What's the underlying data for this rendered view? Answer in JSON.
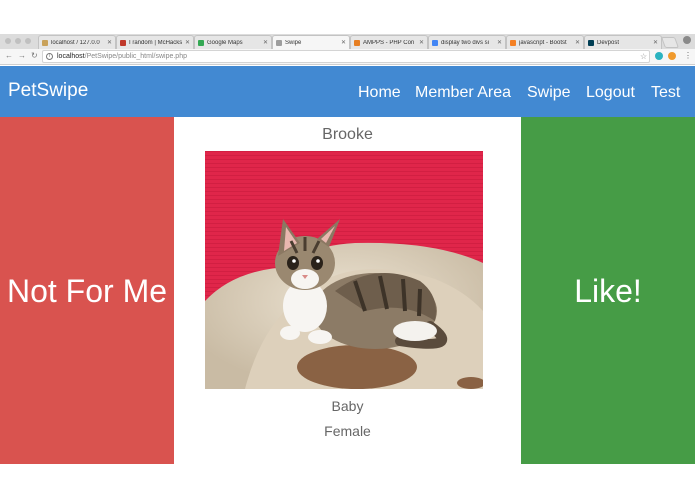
{
  "browser": {
    "tabs": [
      {
        "title": "localhost / 127.0.0",
        "favicon_color": "#c9a25a",
        "active": false
      },
      {
        "title": "I random | McHacks",
        "favicon_color": "#c0392b",
        "active": false
      },
      {
        "title": "Google Maps",
        "favicon_color": "#34a853",
        "active": false
      },
      {
        "title": "Swipe",
        "favicon_color": "#9e9e9e",
        "active": true
      },
      {
        "title": "AMPPS - PHP Con",
        "favicon_color": "#e67e22",
        "active": false
      },
      {
        "title": "display two divs si",
        "favicon_color": "#4285f4",
        "active": false
      },
      {
        "title": "javascript - Bootst",
        "favicon_color": "#f48024",
        "active": false
      },
      {
        "title": "Devpost",
        "favicon_color": "#003e54",
        "active": false
      }
    ],
    "url_host": "localhost",
    "url_path": "/PetSwipe/public_html/swipe.php"
  },
  "navbar": {
    "brand": "PetSwipe",
    "links": [
      "Home",
      "Member Area",
      "Swipe",
      "Logout",
      "Test"
    ],
    "color": "#4289d2"
  },
  "swipe": {
    "reject_label": "Not For Me",
    "accept_label": "Like!",
    "reject_color": "#d9534f",
    "accept_color": "#469c46"
  },
  "pet": {
    "name": "Brooke",
    "age": "Baby",
    "gender": "Female"
  }
}
